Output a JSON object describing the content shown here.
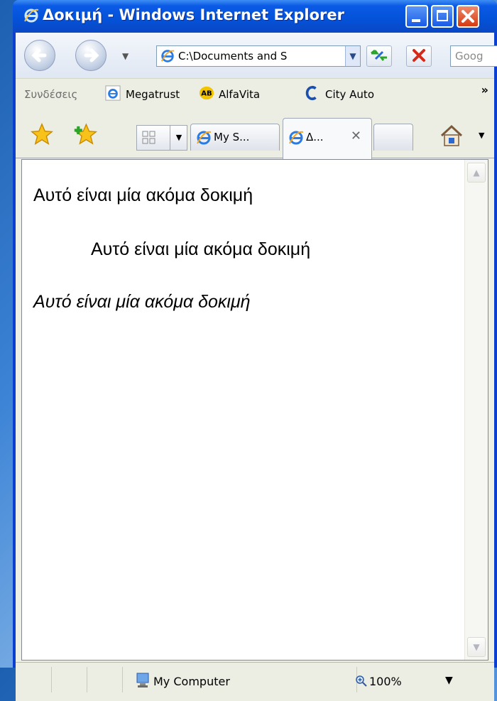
{
  "window": {
    "title": "Δοκιμή - Windows Internet Explorer"
  },
  "navigation": {
    "address": "C:\\Documents and S",
    "search_placeholder": "Goog"
  },
  "links_bar": {
    "label": "Συνδέσεις",
    "items": [
      {
        "label": "Megatrust",
        "icon": "ie-icon"
      },
      {
        "label": "AlfaVita",
        "icon": "ab-icon"
      },
      {
        "label": "City Auto",
        "icon": "c-icon"
      }
    ],
    "overflow": "»"
  },
  "tabs": [
    {
      "label": "My S...",
      "active": false
    },
    {
      "label": "Δ...",
      "active": true,
      "close": "✕"
    }
  ],
  "page": {
    "lines": [
      "Αυτό είναι μία ακόμα δοκιμή",
      "Αυτό είναι μία ακόμα δοκιμή",
      "Αυτό είναι μία ακόμα δοκιμή"
    ]
  },
  "status": {
    "zone": "My Computer",
    "zoom": "100%"
  },
  "colors": {
    "titlebar": "#0452d8",
    "chrome": "#eceee3"
  }
}
